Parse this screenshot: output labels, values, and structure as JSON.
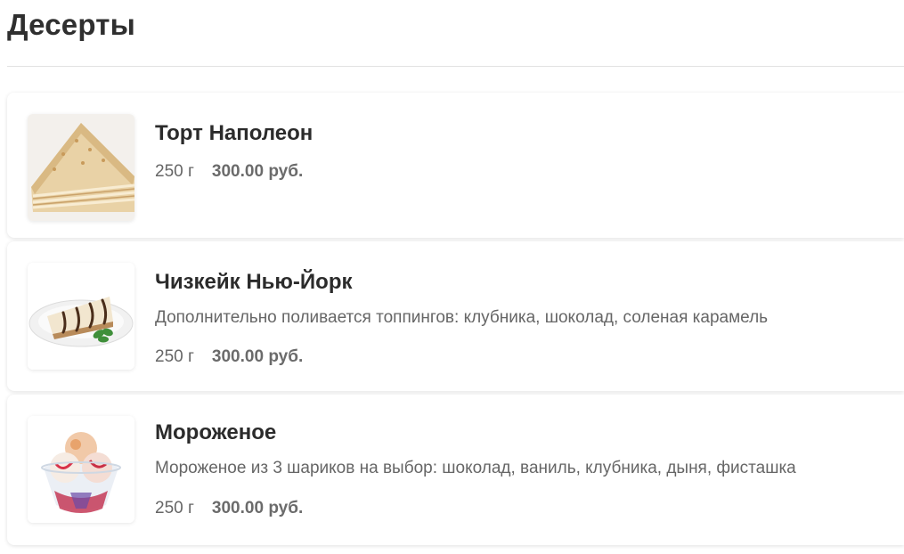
{
  "section": {
    "title": "Десерты"
  },
  "items": [
    {
      "name": "Торт Наполеон",
      "description": "",
      "weight": "250 г",
      "price": "300.00 руб.",
      "image_icon": "napoleon-cake-image"
    },
    {
      "name": "Чизкейк Нью-Йорк",
      "description": "Дополнительно поливается топпингов: клубника, шоколад, соленая карамель",
      "weight": "250 г",
      "price": "300.00 руб.",
      "image_icon": "cheesecake-image"
    },
    {
      "name": "Мороженое",
      "description": "Мороженое из 3 шариков на выбор: шоколад, ваниль, клубника, дыня, фисташка",
      "weight": "250 г",
      "price": "300.00 руб.",
      "image_icon": "ice-cream-image"
    }
  ],
  "colors": {
    "title": "#2f2f2f",
    "text": "#666666",
    "divider": "#e2e2e2"
  }
}
